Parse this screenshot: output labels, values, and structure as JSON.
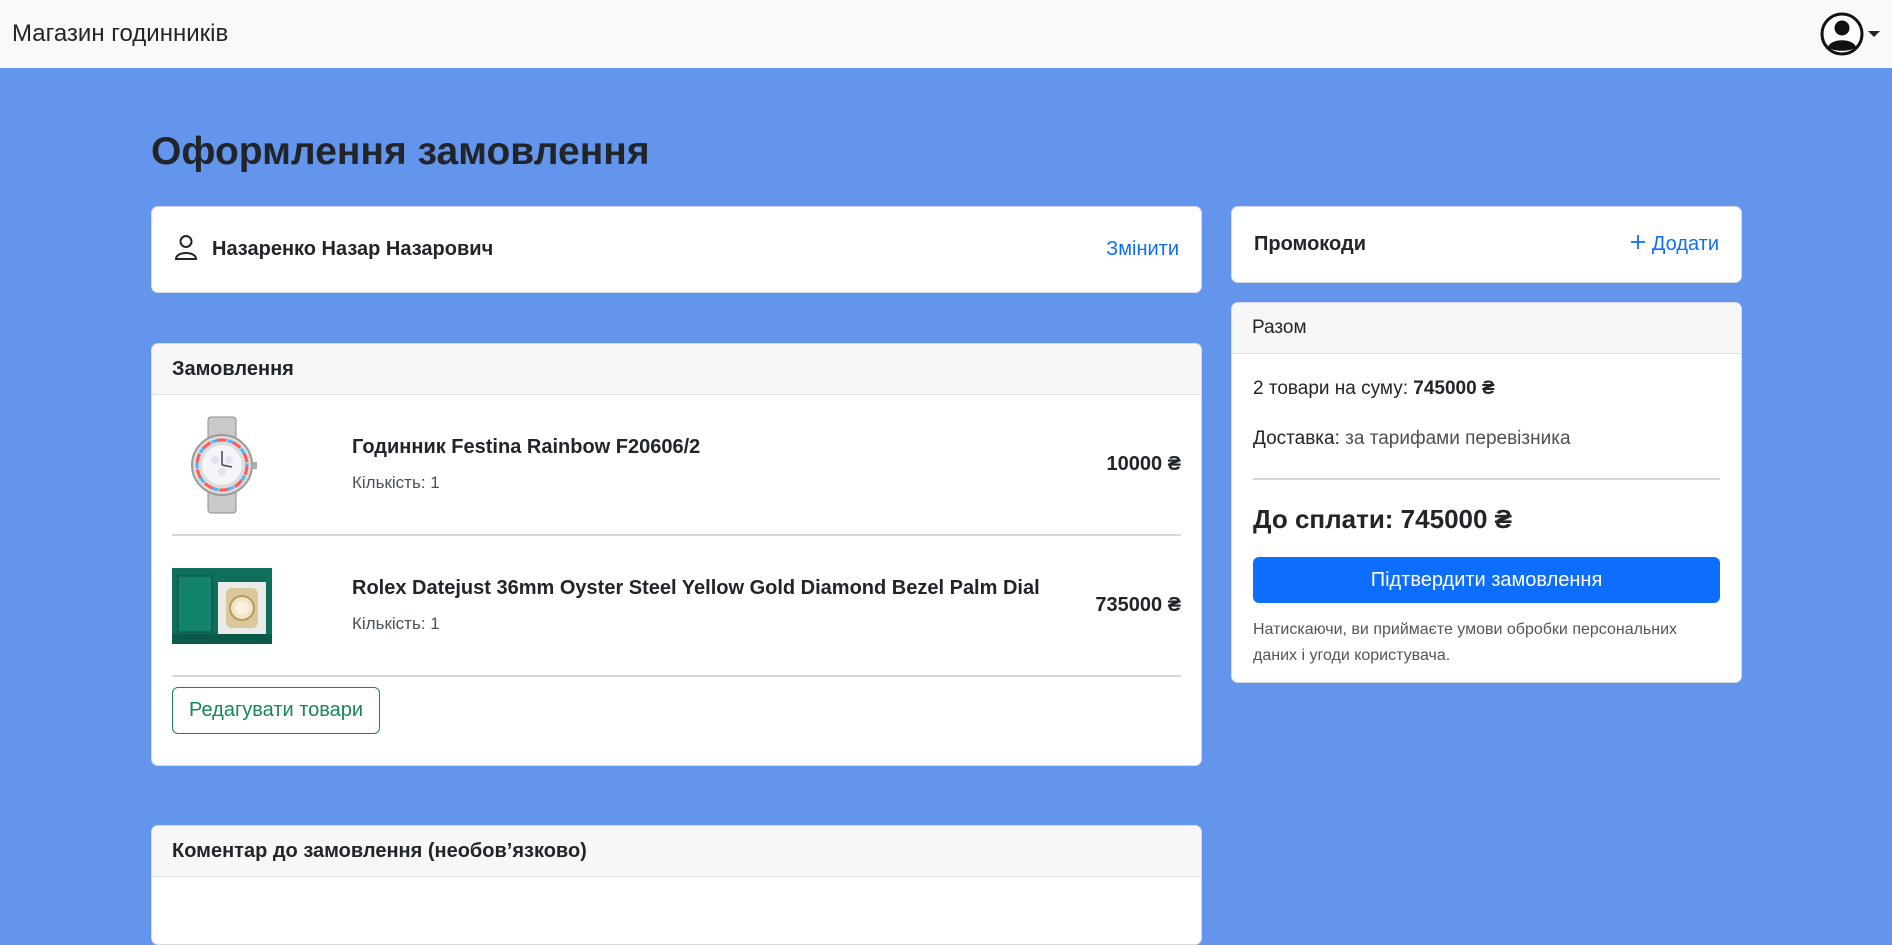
{
  "navbar": {
    "brand": "Магазин годинників",
    "user_icon": "user-circle-icon"
  },
  "page": {
    "title": "Оформлення замовлення"
  },
  "customer": {
    "name": "Назаренко Назар Назарович",
    "change_label": "Змінити"
  },
  "order": {
    "header": "Замовлення",
    "items": [
      {
        "name": "Годинник Festina Rainbow F20606/2",
        "quantity": "Кількість: 1",
        "price": "10000 ₴"
      },
      {
        "name": "Rolex Datejust 36mm Oyster Steel Yellow Gold Diamond Bezel Palm Dial",
        "quantity": "Кількість: 1",
        "price": "735000 ₴"
      }
    ],
    "edit_label": "Редагувати товари"
  },
  "comment": {
    "header": "Коментар до замовлення (необов’язково)"
  },
  "promo": {
    "title": "Промокоди",
    "add_label": "Додати"
  },
  "summary": {
    "header": "Разом",
    "items_prefix": "2 товари на суму: ",
    "items_total": "745000 ₴",
    "delivery_label": "Доставка: ",
    "delivery_value": "за тарифами перевізника",
    "to_pay": "До сплати: 745000 ₴",
    "confirm_label": "Підтвердити замовлення",
    "note": "Натискаючи, ви приймаєте умови обробки персональних даних і угоди користувача."
  },
  "colors": {
    "background": "#6495ed",
    "primary": "#0d6efd",
    "success": "#198754"
  }
}
